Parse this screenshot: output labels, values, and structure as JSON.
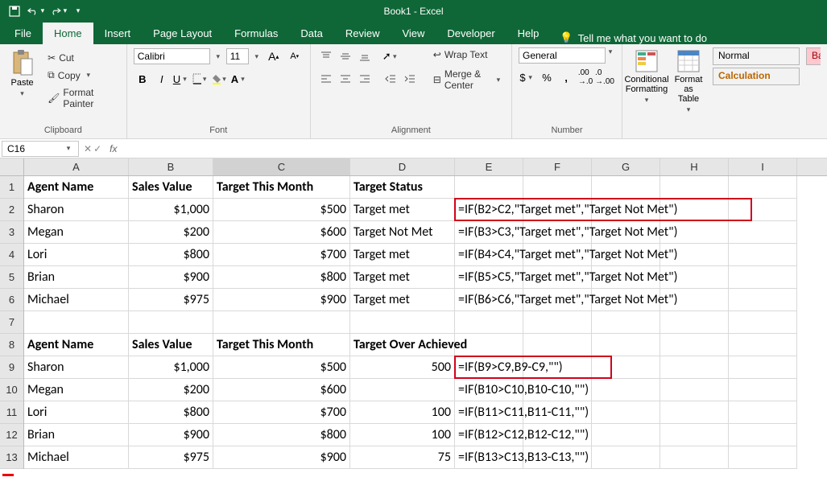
{
  "app": {
    "title": "Book1 - Excel"
  },
  "qat": {
    "save": "Save",
    "undo": "Undo",
    "redo": "Redo"
  },
  "tabs": [
    "File",
    "Home",
    "Insert",
    "Page Layout",
    "Formulas",
    "Data",
    "Review",
    "View",
    "Developer",
    "Help"
  ],
  "active_tab": "Home",
  "tell_me": "Tell me what you want to do",
  "ribbon": {
    "clipboard": {
      "label": "Clipboard",
      "paste": "Paste",
      "cut": "Cut",
      "copy": "Copy",
      "format_painter": "Format Painter"
    },
    "font": {
      "label": "Font",
      "family": "Calibri",
      "size": "11"
    },
    "alignment": {
      "label": "Alignment",
      "wrap": "Wrap Text",
      "merge": "Merge & Center"
    },
    "number": {
      "label": "Number",
      "format": "General"
    },
    "styles": {
      "cond": "Conditional Formatting",
      "table": "Format as Table",
      "normal": "Normal",
      "calc": "Calculation",
      "bad_pre": "Ba"
    }
  },
  "namebox": {
    "cell": "C16",
    "formula": ""
  },
  "columns": [
    "A",
    "B",
    "C",
    "D",
    "E",
    "F",
    "G",
    "H",
    "I"
  ],
  "rows": [
    "1",
    "2",
    "3",
    "4",
    "5",
    "6",
    "7",
    "8",
    "9",
    "10",
    "11",
    "12",
    "13"
  ],
  "chart_data": {
    "type": "table",
    "tables": [
      {
        "headers": [
          "Agent Name",
          "Sales Value",
          "Target This Month",
          "Target Status"
        ],
        "rows": [
          [
            "Sharon",
            "$1,000",
            "$500",
            "Target met"
          ],
          [
            "Megan",
            "$200",
            "$600",
            "Target Not Met"
          ],
          [
            "Lori",
            "$800",
            "$700",
            "Target met"
          ],
          [
            "Brian",
            "$900",
            "$800",
            "Target met"
          ],
          [
            "Michael",
            "$975",
            "$900",
            "Target met"
          ]
        ],
        "formulas": [
          "=IF(B2>C2,\"Target met\",\"Target Not Met\")",
          "=IF(B3>C3,\"Target met\",\"Target Not Met\")",
          "=IF(B4>C4,\"Target met\",\"Target Not Met\")",
          "=IF(B5>C5,\"Target met\",\"Target Not Met\")",
          "=IF(B6>C6,\"Target met\",\"Target Not Met\")"
        ]
      },
      {
        "headers": [
          "Agent Name",
          "Sales Value",
          "Target This Month",
          "Target Over Achieved"
        ],
        "rows": [
          [
            "Sharon",
            "$1,000",
            "$500",
            "500"
          ],
          [
            "Megan",
            "$200",
            "$600",
            ""
          ],
          [
            "Lori",
            "$800",
            "$700",
            "100"
          ],
          [
            "Brian",
            "$900",
            "$800",
            "100"
          ],
          [
            "Michael",
            "$975",
            "$900",
            "75"
          ]
        ],
        "formulas": [
          "=IF(B9>C9,B9-C9,\"\")",
          "=IF(B10>C10,B10-C10,\"\")",
          "=IF(B11>C11,B11-C11,\"\")",
          "=IF(B12>C12,B12-C12,\"\")",
          "=IF(B13>C13,B13-C13,\"\")"
        ]
      }
    ]
  }
}
